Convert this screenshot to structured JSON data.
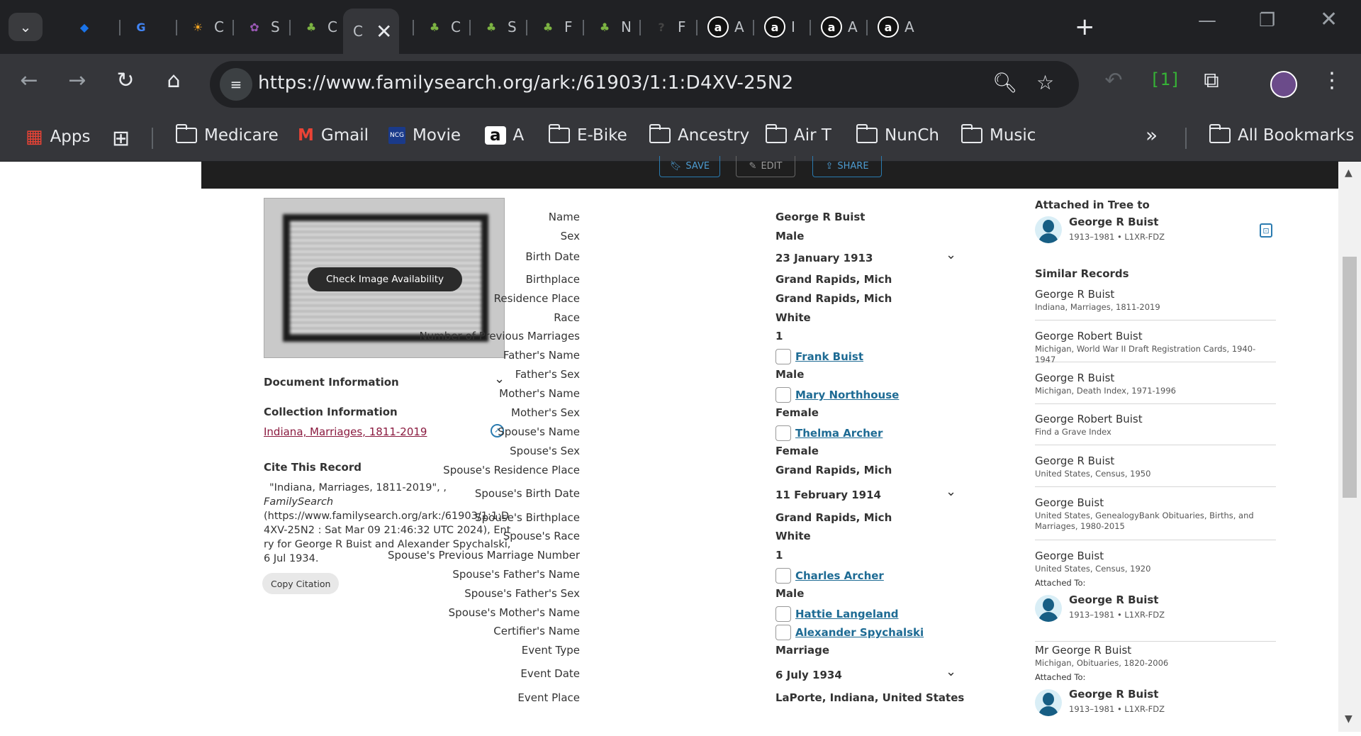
{
  "browser": {
    "tabs": [
      {
        "icon": "diamond-icon",
        "label": ""
      },
      {
        "icon": "translate-icon",
        "label": ""
      },
      {
        "icon": "sun-icon",
        "label": "C"
      },
      {
        "icon": "flower-icon",
        "label": "S"
      },
      {
        "icon": "tree-icon",
        "label": "C"
      },
      {
        "icon": "",
        "label": "C",
        "active": true
      },
      {
        "icon": "tree-icon",
        "label": "C"
      },
      {
        "icon": "tree-icon",
        "label": "S"
      },
      {
        "icon": "tree-icon",
        "label": "F"
      },
      {
        "icon": "tree-icon",
        "label": "N"
      },
      {
        "icon": "help-icon",
        "label": "F"
      },
      {
        "icon": "amazon-icon",
        "label": "A"
      },
      {
        "icon": "amazon-icon",
        "label": "I"
      },
      {
        "icon": "amazon-icon",
        "label": "A"
      },
      {
        "icon": "amazon-icon",
        "label": "A"
      }
    ],
    "url": "https://www.familysearch.org/ark:/61903/1:1:D4XV-25N2",
    "extension_badge": "[1]",
    "bookmarks": [
      {
        "label": "Apps",
        "icon": "apps-grid-icon"
      },
      {
        "label": "",
        "icon": "tab-groups-icon"
      },
      {
        "label": "Medicare",
        "icon": "folder-icon"
      },
      {
        "label": "Gmail",
        "icon": "gmail-icon"
      },
      {
        "label": "Movie",
        "icon": "ncg-icon"
      },
      {
        "label": "A",
        "icon": "amazon-icon"
      },
      {
        "label": "E-Bike",
        "icon": "folder-icon"
      },
      {
        "label": "Ancestry",
        "icon": "folder-icon"
      },
      {
        "label": "Air T",
        "icon": "folder-icon"
      },
      {
        "label": "NunCh",
        "icon": "folder-icon"
      },
      {
        "label": "Music",
        "icon": "folder-icon"
      },
      {
        "label": "All Bookmarks",
        "icon": "folder-icon"
      }
    ]
  },
  "record_toolbar": {
    "save": "SAVE",
    "edit": "EDIT",
    "share": "SHARE"
  },
  "left": {
    "check_image_label": "Check Image Availability",
    "document_information": "Document Information",
    "collection_information": "Collection Information",
    "collection_link": "Indiana, Marriages, 1811-2019",
    "cite_title": "Cite This Record",
    "citation_line1": "\"Indiana, Marriages, 1811-2019\", ,",
    "citation_italic": "FamilySearch",
    "citation_rest": "(https://www.familysearch.org/ark:/61903/1:1:D4XV-25N2 : Sat Mar 09 21:46:32 UTC 2024), Entry for George R Buist and Alexander Spychalski, 6 Jul 1934.",
    "copy_citation": "Copy Citation"
  },
  "facts": [
    {
      "label": "Name",
      "value": "George R Buist"
    },
    {
      "label": "Sex",
      "value": "Male"
    },
    {
      "label": "Birth Date",
      "value": "23 January 1913",
      "expandable": true
    },
    {
      "label": "Birthplace",
      "value": "Grand Rapids, Mich"
    },
    {
      "label": "Residence Place",
      "value": "Grand Rapids, Mich"
    },
    {
      "label": "Race",
      "value": "White"
    },
    {
      "label": "Number of Previous Marriages",
      "value": "1"
    },
    {
      "label": "Father's Name",
      "value": "Frank Buist",
      "link": true
    },
    {
      "label": "Father's Sex",
      "value": "Male"
    },
    {
      "label": "Mother's Name",
      "value": "Mary Northhouse",
      "link": true
    },
    {
      "label": "Mother's Sex",
      "value": "Female"
    },
    {
      "label": "Spouse's Name",
      "value": "Thelma Archer",
      "link": true
    },
    {
      "label": "Spouse's Sex",
      "value": "Female"
    },
    {
      "label": "Spouse's Residence Place",
      "value": "Grand Rapids, Mich"
    },
    {
      "label": "Spouse's Birth Date",
      "value": "11 February 1914",
      "expandable": true
    },
    {
      "label": "Spouse's Birthplace",
      "value": "Grand Rapids, Mich"
    },
    {
      "label": "Spouse's Race",
      "value": "White"
    },
    {
      "label": "Spouse's Previous Marriage Number",
      "value": "1"
    },
    {
      "label": "Spouse's Father's Name",
      "value": "Charles Archer",
      "link": true
    },
    {
      "label": "Spouse's Father's Sex",
      "value": "Male"
    },
    {
      "label": "Spouse's Mother's Name",
      "value": "Hattie Langeland",
      "link": true
    },
    {
      "label": "Certifier's Name",
      "value": "Alexander Spychalski",
      "link": true
    },
    {
      "label": "Event Type",
      "value": "Marriage"
    },
    {
      "label": "Event Date",
      "value": "6 July 1934",
      "expandable": true
    },
    {
      "label": "Event Place",
      "value": "LaPorte, Indiana, United States"
    }
  ],
  "right": {
    "attached_title": "Attached in Tree to",
    "attached_person": {
      "name": "George R Buist",
      "meta": "1913–1981 • L1XR-FDZ"
    },
    "similar_title": "Similar Records",
    "similar": [
      {
        "name": "George R Buist",
        "collection": "Indiana, Marriages, 1811-2019"
      },
      {
        "name": "George Robert Buist",
        "collection": "Michigan, World War II Draft Registration Cards, 1940-1947"
      },
      {
        "name": "George R Buist",
        "collection": "Michigan, Death Index, 1971-1996"
      },
      {
        "name": "George Robert Buist",
        "collection": "Find a Grave Index"
      },
      {
        "name": "George R Buist",
        "collection": "United States, Census, 1950"
      },
      {
        "name": "George Buist",
        "collection": "United States, GenealogyBank Obituaries, Births, and Marriages, 1980-2015"
      },
      {
        "name": "George Buist",
        "collection": "United States, Census, 1920",
        "attached_to": "Attached To:",
        "person": {
          "name": "George R Buist",
          "meta": "1913–1981 • L1XR-FDZ"
        }
      },
      {
        "name": "Mr George R Buist",
        "collection": "Michigan, Obituaries, 1820-2006",
        "attached_to": "Attached To:",
        "person": {
          "name": "George R Buist",
          "meta": "1913–1981 • L1XR-FDZ"
        }
      }
    ]
  }
}
